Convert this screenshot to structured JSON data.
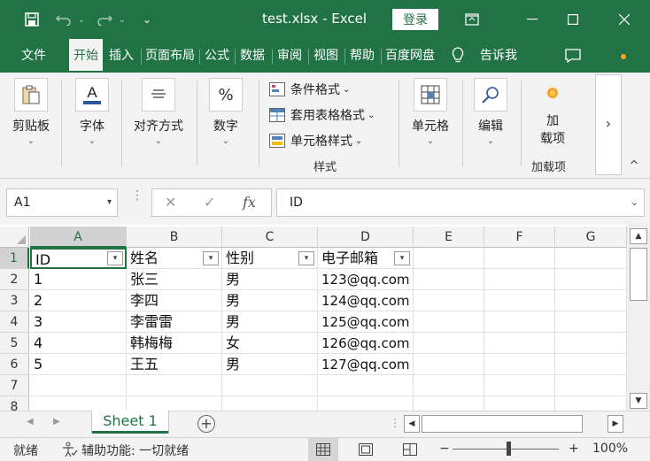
{
  "titlebar": {
    "title": "test.xlsx  -  Excel",
    "login_label": "登录",
    "qat_more": "⌄"
  },
  "tabs": [
    "文件",
    "开始",
    "插入",
    "页面布局",
    "公式",
    "数据",
    "审阅",
    "视图",
    "帮助",
    "百度网盘",
    "告诉我"
  ],
  "active_tab": "开始",
  "ribbon": {
    "clipboard": "剪贴板",
    "font": "字体",
    "alignment": "对齐方式",
    "number": "数字",
    "percent_symbol": "%",
    "conditional_format": "条件格式",
    "table_format": "套用表格格式",
    "cell_style": "单元格样式",
    "styles_group": "样式",
    "cells": "单元格",
    "editing": "编辑",
    "addin_line1": "加",
    "addin_line2": "载项",
    "addins_group": "加载项",
    "more": "›",
    "collapse": "^"
  },
  "formula_bar": {
    "name_box": "A1",
    "formula": "ID",
    "fx": "fx"
  },
  "columns": [
    "A",
    "B",
    "C",
    "D",
    "E",
    "F",
    "G"
  ],
  "rows": [
    "1",
    "2",
    "3",
    "4",
    "5",
    "6",
    "7",
    "8"
  ],
  "table": {
    "headers": [
      "ID",
      "姓名",
      "性别",
      "电子邮箱"
    ],
    "data": [
      [
        "1",
        "张三",
        "男",
        "123@qq.com"
      ],
      [
        "2",
        "李四",
        "男",
        "124@qq.com"
      ],
      [
        "3",
        "李雷雷",
        "男",
        "125@qq.com"
      ],
      [
        "4",
        "韩梅梅",
        "女",
        "126@qq.com"
      ],
      [
        "5",
        "王五",
        "男",
        "127@qq.com"
      ]
    ]
  },
  "sheets": [
    "Sheet 1"
  ],
  "add_sheet": "+",
  "status": {
    "ready": "就绪",
    "accessibility": "辅助功能: 一切就绪",
    "zoom_minus": "−",
    "zoom_plus": "+",
    "zoom": "100%"
  },
  "colors": {
    "accent": "#217346"
  }
}
